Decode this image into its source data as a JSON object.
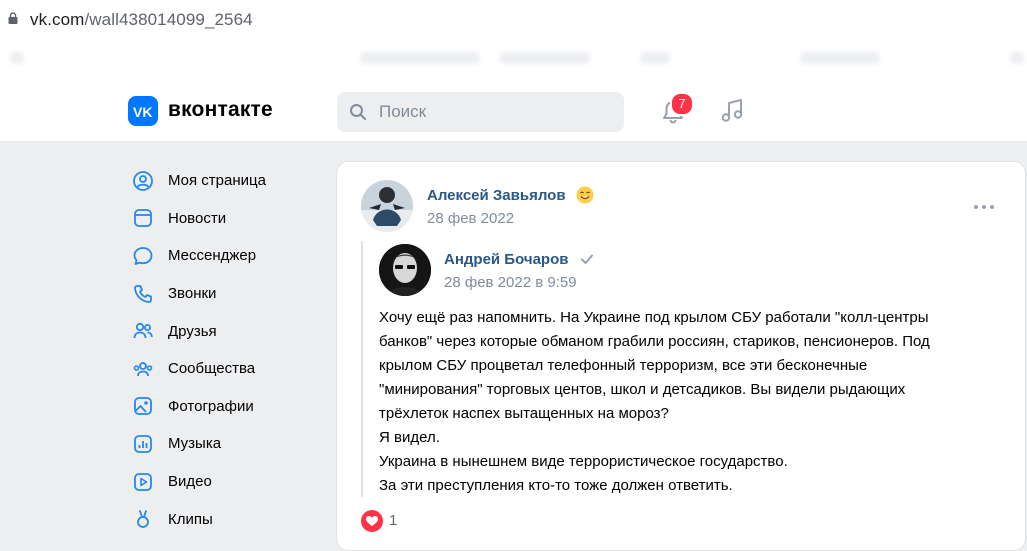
{
  "browser": {
    "url_domain": "vk.com",
    "url_path": "/wall438014099_2564"
  },
  "header": {
    "logo_text": "вконтакте",
    "search_placeholder": "Поиск",
    "notifications_count": "7"
  },
  "sidebar": {
    "items": [
      {
        "label": "Моя страница",
        "icon": "user-circle-icon"
      },
      {
        "label": "Новости",
        "icon": "news-icon"
      },
      {
        "label": "Мессенджер",
        "icon": "message-icon"
      },
      {
        "label": "Звонки",
        "icon": "phone-icon"
      },
      {
        "label": "Друзья",
        "icon": "friends-icon"
      },
      {
        "label": "Сообщества",
        "icon": "communities-icon"
      },
      {
        "label": "Фотографии",
        "icon": "photos-icon"
      },
      {
        "label": "Музыка",
        "icon": "music-icon"
      },
      {
        "label": "Видео",
        "icon": "video-icon"
      },
      {
        "label": "Клипы",
        "icon": "clips-icon"
      }
    ]
  },
  "post": {
    "author": "Алексей Завьялов",
    "date": "28 фев 2022",
    "repost": {
      "author": "Андрей Бочаров",
      "date": "28 фев 2022 в 9:59",
      "text_lines": [
        "Хочу ещё раз напомнить. На Украине под крылом СБУ работали \"колл-центры",
        "банков\" через которые обманом грабили россиян, стариков, пенсионеров. Под",
        "крылом СБУ процветал телефонный терроризм, все эти бесконечные",
        "\"минирования\" торговых центов, школ и детсадиков. Вы видели рыдающих",
        "трёхлеток наспех вытащенных на мороз?",
        "Я видел.",
        "Украина в нынешнем виде террористическое государство.",
        "За эти преступления кто-то тоже должен ответить."
      ]
    },
    "likes": "1"
  },
  "colors": {
    "accent": "#0077ff",
    "link": "#2a5885",
    "secondary_text": "#818c99",
    "badge": "#ff3347",
    "like": "#ff3347"
  }
}
